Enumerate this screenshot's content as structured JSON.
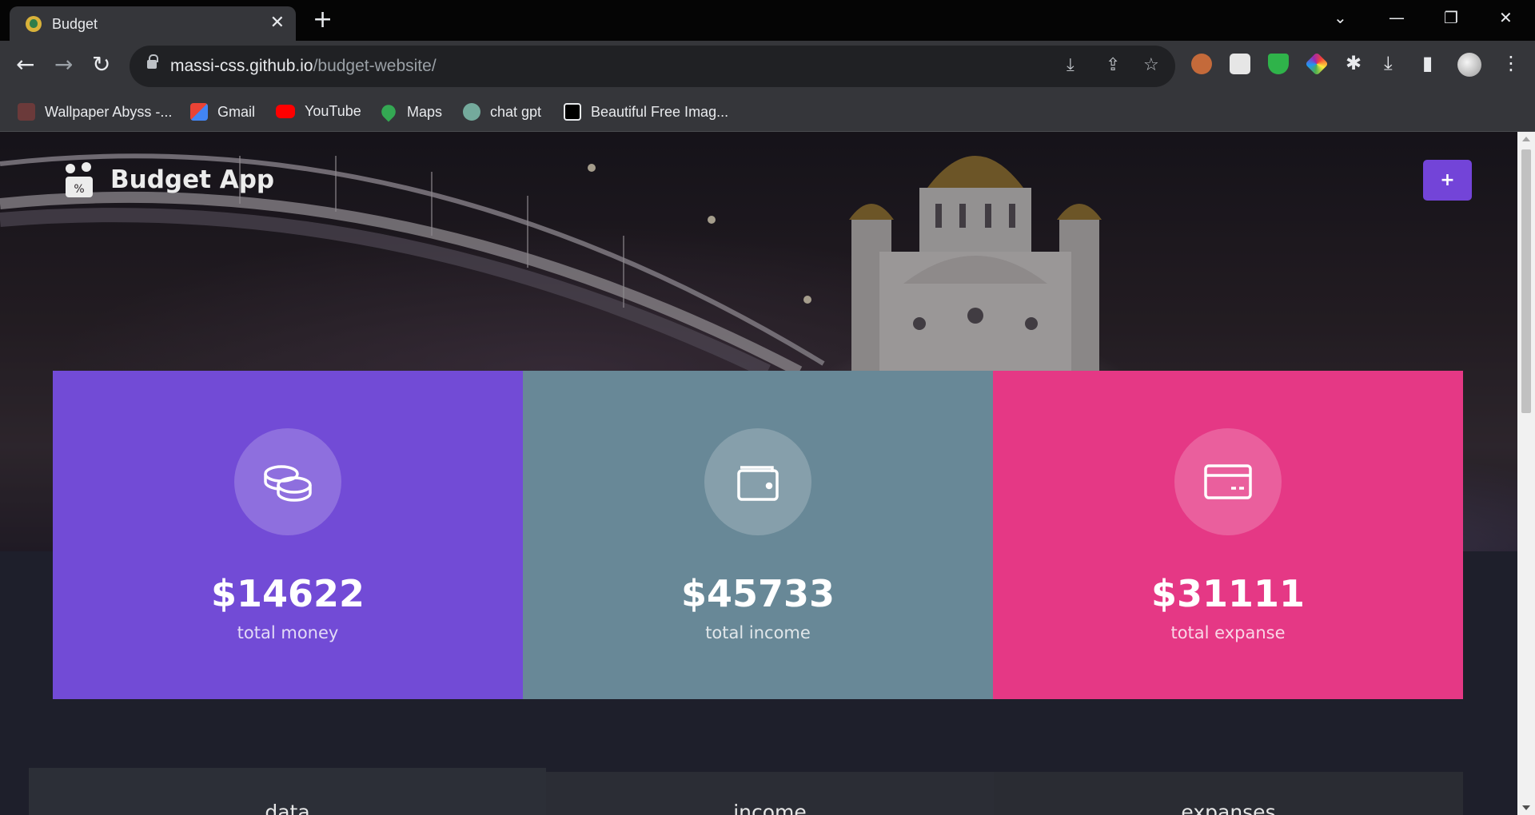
{
  "browser": {
    "tab_title": "Budget",
    "tab_close": "✕",
    "new_tab": "+",
    "url_host": "massi-css.github.io",
    "url_path": "/budget-website/",
    "nav": {
      "back": "←",
      "forward": "→",
      "reload": "↻"
    },
    "window_controls": {
      "dropdown": "⌄",
      "minimize": "—",
      "restore": "❐",
      "close": "✕"
    },
    "omnibox_icons": {
      "install": "⤓",
      "share": "⇪",
      "star": "☆"
    },
    "toolbar_icons": {
      "extensions": "✱",
      "download": "⤓",
      "side_panel": "▮",
      "menu": "⋮"
    },
    "bookmarks": [
      {
        "label": "Wallpaper Abyss -...",
        "icon": "wallpaper-abyss-icon",
        "color": "#6b3a3a"
      },
      {
        "label": "Gmail",
        "icon": "gmail-icon",
        "color": "#ea4335"
      },
      {
        "label": "YouTube",
        "icon": "youtube-icon",
        "color": "#ff0000"
      },
      {
        "label": "Maps",
        "icon": "maps-icon",
        "color": "#34a853"
      },
      {
        "label": "chat gpt",
        "icon": "chatgpt-icon",
        "color": "#74aa9c"
      },
      {
        "label": "Beautiful Free Imag...",
        "icon": "unsplash-icon",
        "color": "#000000"
      }
    ]
  },
  "app": {
    "title": "Budget App",
    "add_button": "+",
    "accent": "#7344d8",
    "cards": [
      {
        "amount": "$14622",
        "label": "total money",
        "icon": "coins-icon",
        "color": "#724bd6"
      },
      {
        "amount": "$45733",
        "label": "total income",
        "icon": "wallet-icon",
        "color": "#688897"
      },
      {
        "amount": "$31111",
        "label": "total expanse",
        "icon": "credit-card-icon",
        "color": "#e53885"
      }
    ],
    "panels": [
      {
        "title": "data"
      },
      {
        "title": "income"
      },
      {
        "title": "expanses"
      }
    ]
  }
}
